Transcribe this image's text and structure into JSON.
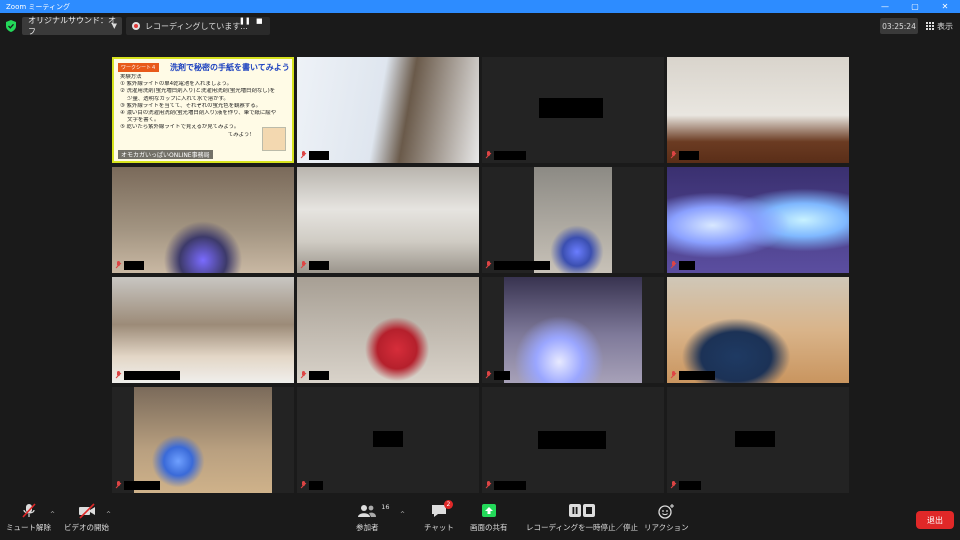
{
  "window": {
    "title": "Zoom ミーティング",
    "controls": [
      "—",
      "▢",
      "✕"
    ]
  },
  "topbar": {
    "audio_select": "オリジナルサウンド：オフ",
    "recording_status": "レコーディングしています...",
    "pause_glyph": "❚❚",
    "stop_glyph": "■",
    "timer": "03:25:24",
    "view_label": "表示"
  },
  "worksheet": {
    "tag": "ワークシート４",
    "title": "洗剤で秘密の手紙を書いてみよう",
    "lines": [
      "実験方法",
      "① 紫外線ライトの単4乾電池を入れましょう。",
      "② 洗濯用洗剤(蛍光増白剤入り)と洗濯用洗剤(蛍光増白剤なし)を",
      "　 少量、透明なカップに入れて水で溶かす。",
      "③ 紫外線ライトを当てて、それぞれの蛍光色を観察する。",
      "④ 濃い目の洗濯用洗剤(蛍光増白剤入り)液を作り、筆で紙に絵や",
      "　 文字を書く。",
      "⑤ 乾いたら紫外線ライトで見えるか見てみよう。",
      "　　　　　　　　　　　　　　　　　　　　てみよう！"
    ],
    "caption": "オモカガいっぱいONLINE事務局"
  },
  "toolbar": {
    "mute_label": "ミュート解除",
    "video_label": "ビデオの開始",
    "participants_label": "参加者",
    "participants_count": "16",
    "chat_label": "チャット",
    "chat_badge": "2",
    "share_label": "画面の共有",
    "pause_recording_label": "レコーディングを一時停止／停止",
    "reactions_label": "リアクション",
    "leave_label": "退出",
    "caret": "^"
  },
  "colors": {
    "zoom_blue": "#2d8cff",
    "share_green": "#23d959",
    "leave_red": "#e02828",
    "muted_red": "#dd4444",
    "worksheet_border": "#d7e31f"
  }
}
